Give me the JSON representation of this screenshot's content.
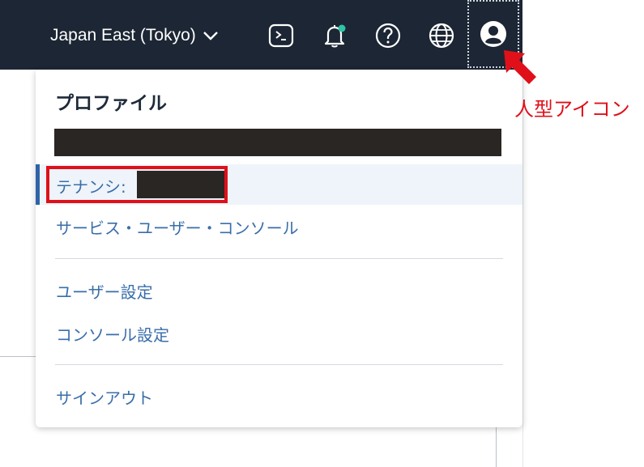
{
  "topbar": {
    "region_label": "Japan East (Tokyo)",
    "icons": [
      "cloud-shell-icon",
      "bell-icon",
      "help-icon",
      "globe-icon",
      "profile-icon"
    ],
    "notification_dot_color": "#2ec4a5"
  },
  "menu": {
    "title": "プロファイル",
    "tenant_label": "テナンシ:",
    "items": [
      "サービス・ユーザー・コンソール",
      "ユーザー設定",
      "コンソール設定",
      "サインアウト"
    ]
  },
  "annotation": {
    "label": "人型アイコン",
    "color": "#e0101a"
  }
}
